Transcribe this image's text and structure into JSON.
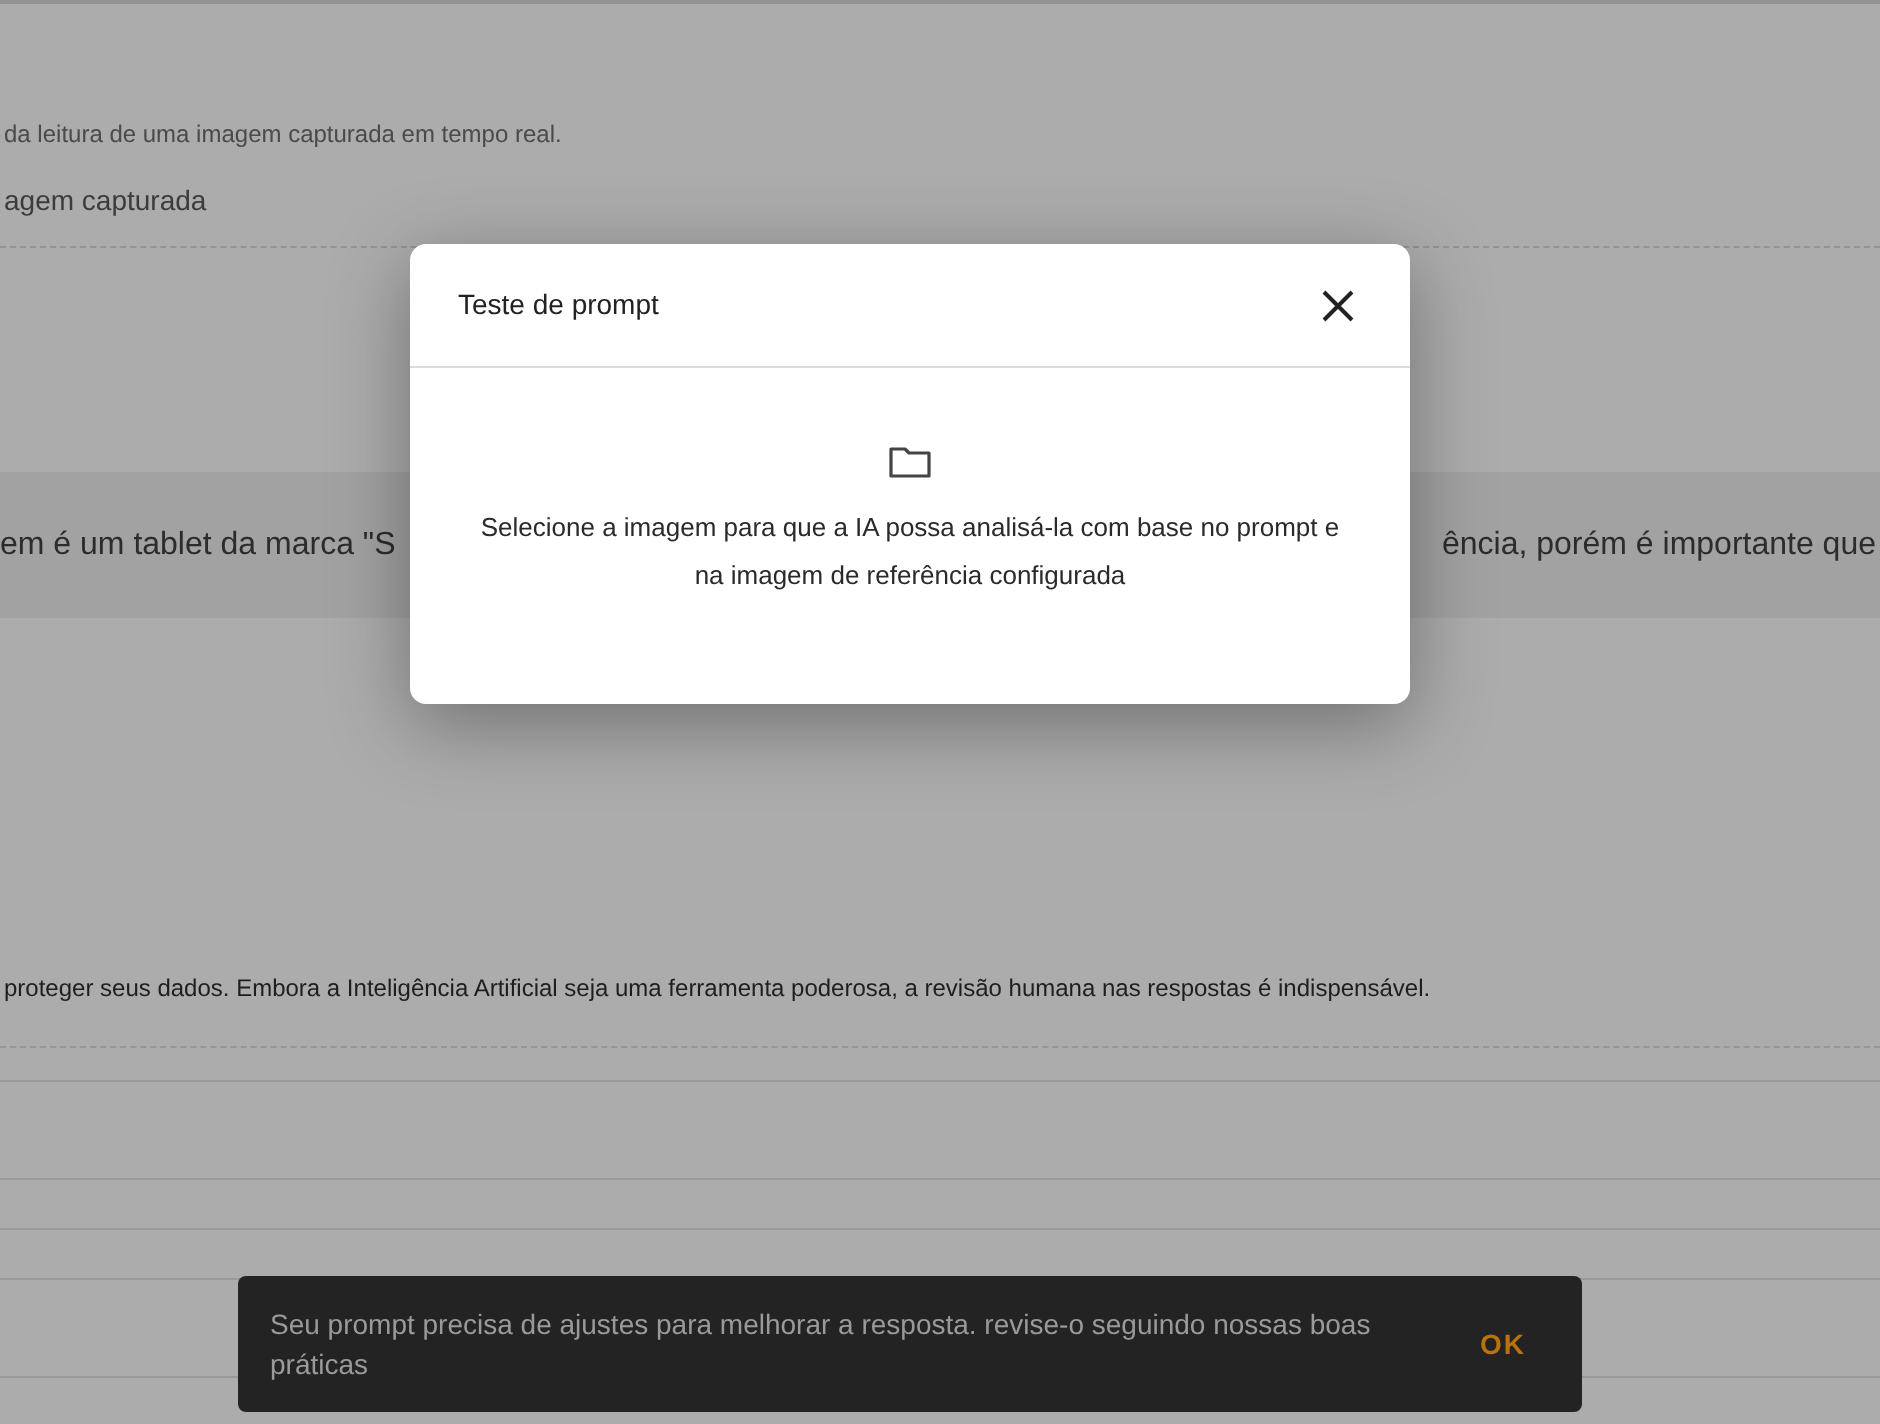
{
  "page": {
    "description": "da leitura de uma imagem capturada em tempo real.",
    "section_label": "agem capturada",
    "example_left": "em é um tablet da marca \"S",
    "example_right": "ência, porém é importante que",
    "notice": "proteger seus dados. Embora a Inteligência Artificial seja uma ferramenta poderosa, a revisão humana nas respostas é indispensável."
  },
  "dialog": {
    "title": "Teste de prompt",
    "message": "Selecione a imagem para que a IA possa analisá-la com base no prompt e na imagem de referência configurada"
  },
  "snackbar": {
    "message": "Seu prompt precisa de ajustes para melhorar a resposta. revise-o seguindo nossas boas práticas",
    "action": "OK"
  }
}
